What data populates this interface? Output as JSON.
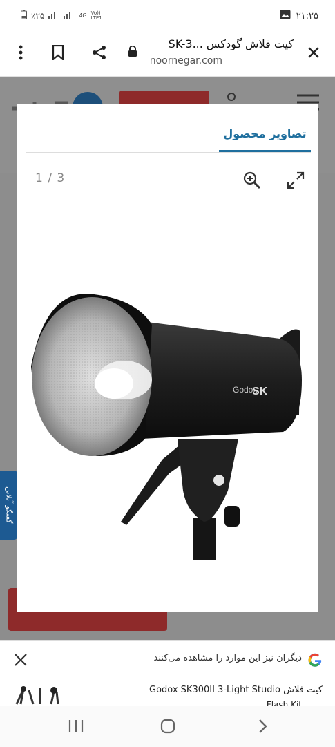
{
  "status": {
    "time": "۲۱:۲۵",
    "battery": "٪۲۵",
    "network_label": "4G",
    "volte_label": "Vo)) LTE1"
  },
  "browser": {
    "page_title": "کیت فلاش گودکس ...SK-3",
    "domain": "noornegar.com"
  },
  "site": {
    "side_tab_label": "گفتگو آنلاین"
  },
  "modal": {
    "tab_label": "تصاویر محصول",
    "counter": "1 / 3"
  },
  "product": {
    "brand_badge": "Godox",
    "model_badge": "SK"
  },
  "google_bar": {
    "message": "دیگران نیز این موارد را مشاهده می‌کنند",
    "item_title": "کیت فلاش Godox SK300II 3-Light Studio",
    "item_subtitle": "Flash Kit"
  },
  "colors": {
    "accent": "#1f6f9e",
    "dim_overlay": "#8d8d8d",
    "site_red": "#8e2a2a"
  }
}
